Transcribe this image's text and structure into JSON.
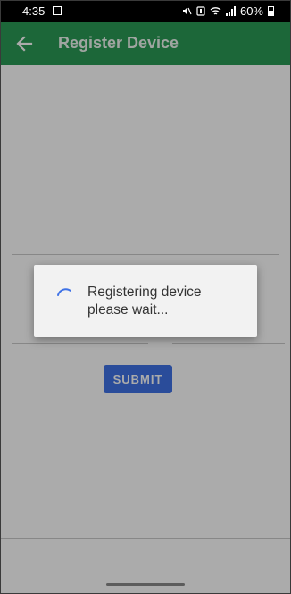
{
  "status_bar": {
    "time": "4:35",
    "battery": "60%",
    "icons": [
      "image-icon",
      "mute-icon",
      "nfc-icon",
      "wifi-icon",
      "signal-icon",
      "battery-icon"
    ]
  },
  "app_bar": {
    "title": "Register Device",
    "back_icon": "arrow-back-icon",
    "color": "#2a9a55"
  },
  "form": {
    "submit_label": "SUBMIT",
    "submit_color": "#3f72e6"
  },
  "dialog": {
    "line1": "Registering device",
    "line2": "please wait...",
    "spinner_icon": "progress-spinner-icon",
    "accent": "#3f72e6"
  }
}
